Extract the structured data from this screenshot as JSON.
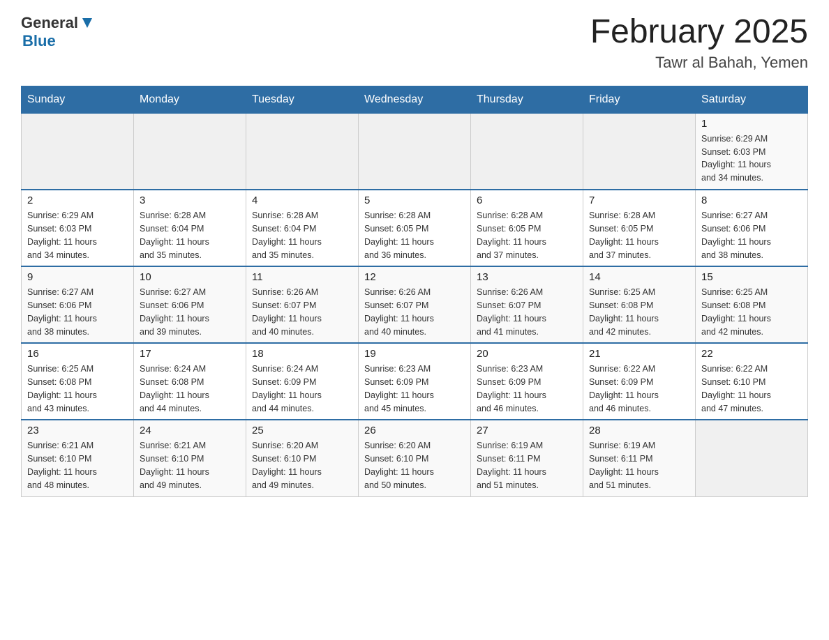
{
  "header": {
    "logo_general": "General",
    "logo_blue": "Blue",
    "title": "February 2025",
    "subtitle": "Tawr al Bahah, Yemen"
  },
  "days_of_week": [
    "Sunday",
    "Monday",
    "Tuesday",
    "Wednesday",
    "Thursday",
    "Friday",
    "Saturday"
  ],
  "weeks": [
    [
      {
        "day": "",
        "info": ""
      },
      {
        "day": "",
        "info": ""
      },
      {
        "day": "",
        "info": ""
      },
      {
        "day": "",
        "info": ""
      },
      {
        "day": "",
        "info": ""
      },
      {
        "day": "",
        "info": ""
      },
      {
        "day": "1",
        "info": "Sunrise: 6:29 AM\nSunset: 6:03 PM\nDaylight: 11 hours\nand 34 minutes."
      }
    ],
    [
      {
        "day": "2",
        "info": "Sunrise: 6:29 AM\nSunset: 6:03 PM\nDaylight: 11 hours\nand 34 minutes."
      },
      {
        "day": "3",
        "info": "Sunrise: 6:28 AM\nSunset: 6:04 PM\nDaylight: 11 hours\nand 35 minutes."
      },
      {
        "day": "4",
        "info": "Sunrise: 6:28 AM\nSunset: 6:04 PM\nDaylight: 11 hours\nand 35 minutes."
      },
      {
        "day": "5",
        "info": "Sunrise: 6:28 AM\nSunset: 6:05 PM\nDaylight: 11 hours\nand 36 minutes."
      },
      {
        "day": "6",
        "info": "Sunrise: 6:28 AM\nSunset: 6:05 PM\nDaylight: 11 hours\nand 37 minutes."
      },
      {
        "day": "7",
        "info": "Sunrise: 6:28 AM\nSunset: 6:05 PM\nDaylight: 11 hours\nand 37 minutes."
      },
      {
        "day": "8",
        "info": "Sunrise: 6:27 AM\nSunset: 6:06 PM\nDaylight: 11 hours\nand 38 minutes."
      }
    ],
    [
      {
        "day": "9",
        "info": "Sunrise: 6:27 AM\nSunset: 6:06 PM\nDaylight: 11 hours\nand 38 minutes."
      },
      {
        "day": "10",
        "info": "Sunrise: 6:27 AM\nSunset: 6:06 PM\nDaylight: 11 hours\nand 39 minutes."
      },
      {
        "day": "11",
        "info": "Sunrise: 6:26 AM\nSunset: 6:07 PM\nDaylight: 11 hours\nand 40 minutes."
      },
      {
        "day": "12",
        "info": "Sunrise: 6:26 AM\nSunset: 6:07 PM\nDaylight: 11 hours\nand 40 minutes."
      },
      {
        "day": "13",
        "info": "Sunrise: 6:26 AM\nSunset: 6:07 PM\nDaylight: 11 hours\nand 41 minutes."
      },
      {
        "day": "14",
        "info": "Sunrise: 6:25 AM\nSunset: 6:08 PM\nDaylight: 11 hours\nand 42 minutes."
      },
      {
        "day": "15",
        "info": "Sunrise: 6:25 AM\nSunset: 6:08 PM\nDaylight: 11 hours\nand 42 minutes."
      }
    ],
    [
      {
        "day": "16",
        "info": "Sunrise: 6:25 AM\nSunset: 6:08 PM\nDaylight: 11 hours\nand 43 minutes."
      },
      {
        "day": "17",
        "info": "Sunrise: 6:24 AM\nSunset: 6:08 PM\nDaylight: 11 hours\nand 44 minutes."
      },
      {
        "day": "18",
        "info": "Sunrise: 6:24 AM\nSunset: 6:09 PM\nDaylight: 11 hours\nand 44 minutes."
      },
      {
        "day": "19",
        "info": "Sunrise: 6:23 AM\nSunset: 6:09 PM\nDaylight: 11 hours\nand 45 minutes."
      },
      {
        "day": "20",
        "info": "Sunrise: 6:23 AM\nSunset: 6:09 PM\nDaylight: 11 hours\nand 46 minutes."
      },
      {
        "day": "21",
        "info": "Sunrise: 6:22 AM\nSunset: 6:09 PM\nDaylight: 11 hours\nand 46 minutes."
      },
      {
        "day": "22",
        "info": "Sunrise: 6:22 AM\nSunset: 6:10 PM\nDaylight: 11 hours\nand 47 minutes."
      }
    ],
    [
      {
        "day": "23",
        "info": "Sunrise: 6:21 AM\nSunset: 6:10 PM\nDaylight: 11 hours\nand 48 minutes."
      },
      {
        "day": "24",
        "info": "Sunrise: 6:21 AM\nSunset: 6:10 PM\nDaylight: 11 hours\nand 49 minutes."
      },
      {
        "day": "25",
        "info": "Sunrise: 6:20 AM\nSunset: 6:10 PM\nDaylight: 11 hours\nand 49 minutes."
      },
      {
        "day": "26",
        "info": "Sunrise: 6:20 AM\nSunset: 6:10 PM\nDaylight: 11 hours\nand 50 minutes."
      },
      {
        "day": "27",
        "info": "Sunrise: 6:19 AM\nSunset: 6:11 PM\nDaylight: 11 hours\nand 51 minutes."
      },
      {
        "day": "28",
        "info": "Sunrise: 6:19 AM\nSunset: 6:11 PM\nDaylight: 11 hours\nand 51 minutes."
      },
      {
        "day": "",
        "info": ""
      }
    ]
  ]
}
